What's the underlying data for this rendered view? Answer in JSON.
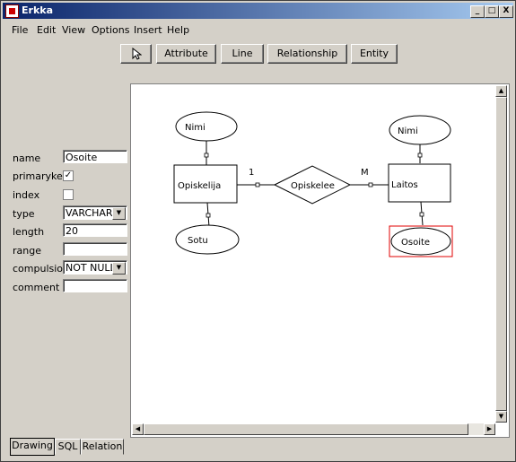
{
  "window": {
    "title": "Erkka",
    "minimize": "_",
    "maximize": "□",
    "close": "X"
  },
  "menu": [
    "File",
    "Edit",
    "View",
    "Options",
    "Insert",
    "Help"
  ],
  "toolbar": {
    "pointer_tool": "pointer-icon",
    "attribute": "Attribute",
    "line": "Line",
    "relationship": "Relationship",
    "entity": "Entity"
  },
  "properties": {
    "name": {
      "label": "name",
      "value": "Osoite"
    },
    "primarykey": {
      "label": "primarykey",
      "checked": true,
      "mark": "✓"
    },
    "index": {
      "label": "index",
      "checked": false
    },
    "type": {
      "label": "type",
      "value": "VARCHAR"
    },
    "length": {
      "label": "length",
      "value": "20"
    },
    "range": {
      "label": "range",
      "value": ""
    },
    "compulsion": {
      "label": "compulsion",
      "value": "NOT NULL"
    },
    "comment": {
      "label": "comment",
      "value": ""
    }
  },
  "diagram": {
    "entities": [
      "Opiskelija",
      "Laitos"
    ],
    "relationship": "Opiskelee",
    "attributes": [
      "Nimi",
      "Sotu",
      "Nimi",
      "Osoite"
    ],
    "cardinality_left": "1",
    "cardinality_right": "M",
    "selected_attribute": "Osoite",
    "selection_color": "#e00000"
  },
  "tabs": [
    "Drawing",
    "SQL",
    "Relation"
  ],
  "colors": {
    "titlebar_start": "#0a246a",
    "titlebar_end": "#a6caf0",
    "face": "#d4d0c8"
  }
}
